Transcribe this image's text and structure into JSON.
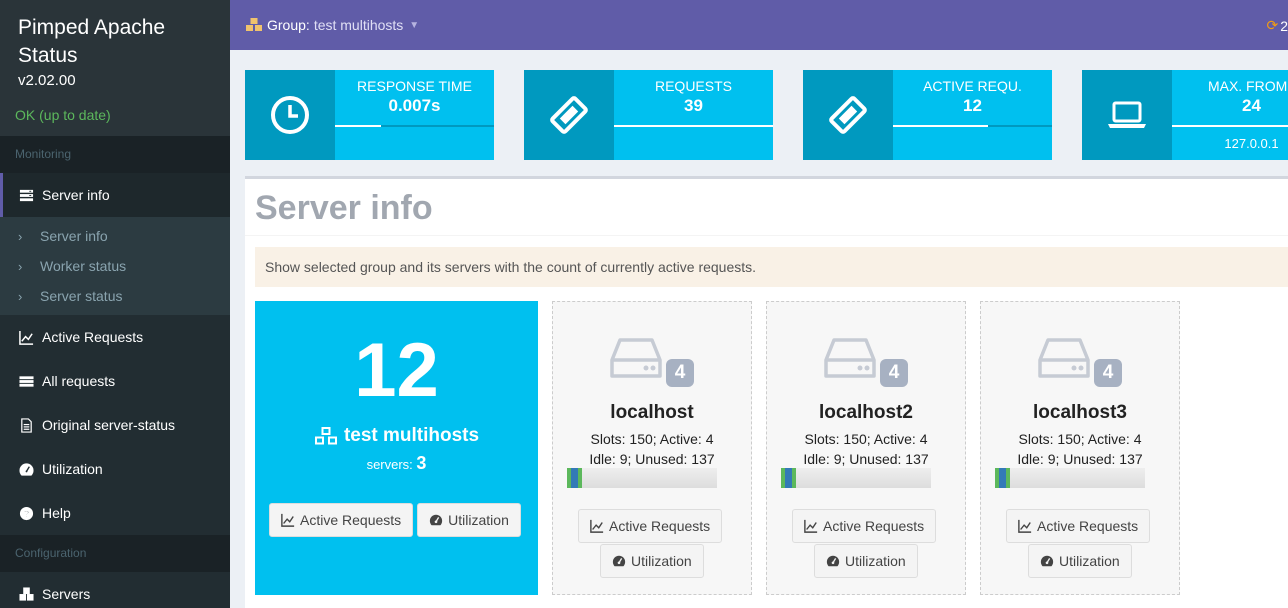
{
  "brand": {
    "title": "Pimped Apache Status",
    "version": "v2.02.00",
    "status": "OK (up to date)"
  },
  "sidebar": {
    "section_monitoring": "Monitoring",
    "server_info": "Server info",
    "sub_items": [
      "Server info",
      "Worker status",
      "Server status"
    ],
    "active_requests": "Active Requests",
    "all_requests": "All requests",
    "original_status": "Original server-status",
    "utilization": "Utilization",
    "help": "Help",
    "section_configuration": "Configuration",
    "servers": "Servers"
  },
  "header": {
    "group_label": "Group:",
    "group_value": "test multihosts",
    "refresh_text": "2"
  },
  "infoboxes": [
    {
      "label": "RESPONSE TIME",
      "value": "0.007s",
      "progress": 0.29,
      "desc": ""
    },
    {
      "label": "REQUESTS",
      "value": "39",
      "progress": 1.0,
      "desc": ""
    },
    {
      "label": "ACTIVE REQU.",
      "value": "12",
      "progress": 0.6,
      "desc": ""
    },
    {
      "label": "MAX. FROM I",
      "value": "24",
      "progress": 1.0,
      "desc": "127.0.0.1"
    }
  ],
  "main": {
    "title": "Server info",
    "callout": "Show selected group and its servers with the count of currently active requests.",
    "group": {
      "count": "12",
      "name": "test multihosts",
      "servers_label": "servers:",
      "servers_count": "3",
      "btn_active": "Active Requests",
      "btn_util": "Utilization"
    },
    "servers": [
      {
        "name": "localhost",
        "badge": "4",
        "slots_line": "Slots: 150; Active: 4",
        "idle_line": "Idle: 9; Unused: 137",
        "btn_active": "Active Requests",
        "btn_util": "Utilization"
      },
      {
        "name": "localhost2",
        "badge": "4",
        "slots_line": "Slots: 150; Active: 4",
        "idle_line": "Idle: 9; Unused: 137",
        "btn_active": "Active Requests",
        "btn_util": "Utilization"
      },
      {
        "name": "localhost3",
        "badge": "4",
        "slots_line": "Slots: 150; Active: 4",
        "idle_line": "Idle: 9; Unused: 137",
        "btn_active": "Active Requests",
        "btn_util": "Utilization"
      }
    ],
    "slot_usage": {
      "slots": 150,
      "active": 4,
      "idle": 9
    }
  },
  "colors": {
    "sidebar_bg": "#222d32",
    "header_bg": "#605ca8",
    "aqua": "#00c0ef",
    "aqua_dark": "#0099bf",
    "status_ok": "#5cb85c",
    "refresh": "#f39c12"
  }
}
